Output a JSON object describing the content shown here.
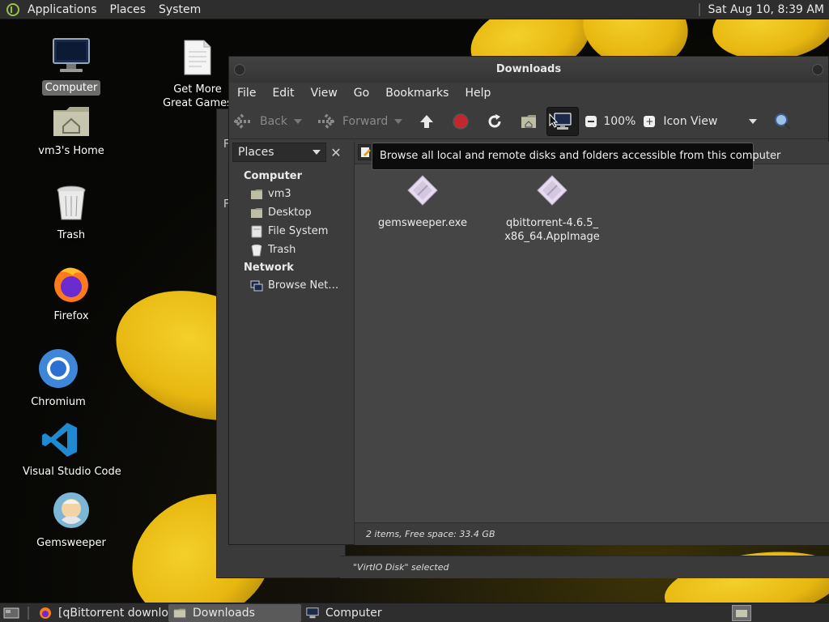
{
  "top_panel": {
    "menus": [
      "Applications",
      "Places",
      "System"
    ],
    "clock": "Sat Aug 10,  8:39 AM"
  },
  "desktop_icons": {
    "computer": "Computer",
    "games": "Get More Great Games",
    "home": "vm3's Home",
    "trash": "Trash",
    "firefox": "Firefox",
    "chromium": "Chromium",
    "vscode": "Visual Studio Code",
    "gemsweeper": "Gemsweeper"
  },
  "window": {
    "title": "Downloads",
    "menu": [
      "File",
      "Edit",
      "View",
      "Go",
      "Bookmarks",
      "Help"
    ],
    "toolbar": {
      "back": "Back",
      "forward": "Forward",
      "zoom": "100%",
      "view_mode": "Icon View"
    },
    "sidebar": {
      "combo": "Places",
      "groups": {
        "computer": "Computer",
        "network": "Network"
      },
      "computer_items": [
        "vm3",
        "Desktop",
        "File System",
        "Trash"
      ],
      "network_items": [
        "Browse Net…"
      ]
    },
    "files": [
      {
        "line1": "gemsweeper.exe",
        "line2": ""
      },
      {
        "line1": "qbittorrent-4.6.5_",
        "line2": "x86_64.AppImage"
      }
    ],
    "status": "2 items, Free space: 33.4 GB"
  },
  "back_window": {
    "status": "\"VirtIO Disk\" selected"
  },
  "tooltip": "Browse all local and remote disks and folders accessible from this computer",
  "taskbar": {
    "items": [
      "[qBittorrent downlo…",
      "Downloads",
      "Computer"
    ]
  },
  "colors": {
    "panel_bg": "#2e2e2e",
    "window_bg": "#3c3c3c",
    "content_bg": "#454545",
    "flower_yellow": "#e7b710",
    "stop_red": "#c0282d"
  }
}
